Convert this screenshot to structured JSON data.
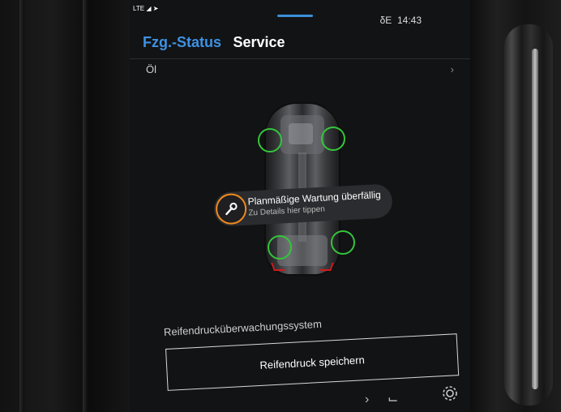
{
  "status": {
    "network": "LTE",
    "extra": "δΕ",
    "time": "14:43"
  },
  "tabs": [
    {
      "label": "Fzg.-Status",
      "active": true
    },
    {
      "label": "Service",
      "active": false
    }
  ],
  "oil": {
    "label": "Öl"
  },
  "notification": {
    "title": "Planmäßige Wartung überfällig",
    "subtitle": "Zu Details hier tippen",
    "icon": "wrench-icon"
  },
  "tpms": {
    "label": "Reifendrucküberwachungssystem",
    "button": "Reifendruck speichern"
  },
  "bottom_bar": {
    "icons": [
      "chevron-right-icon",
      "seat-icon",
      "gear-icon"
    ]
  },
  "colors": {
    "accent": "#3d92e3",
    "tire_ok": "#34c53a",
    "warning": "#f08a1c",
    "background": "#121315"
  }
}
